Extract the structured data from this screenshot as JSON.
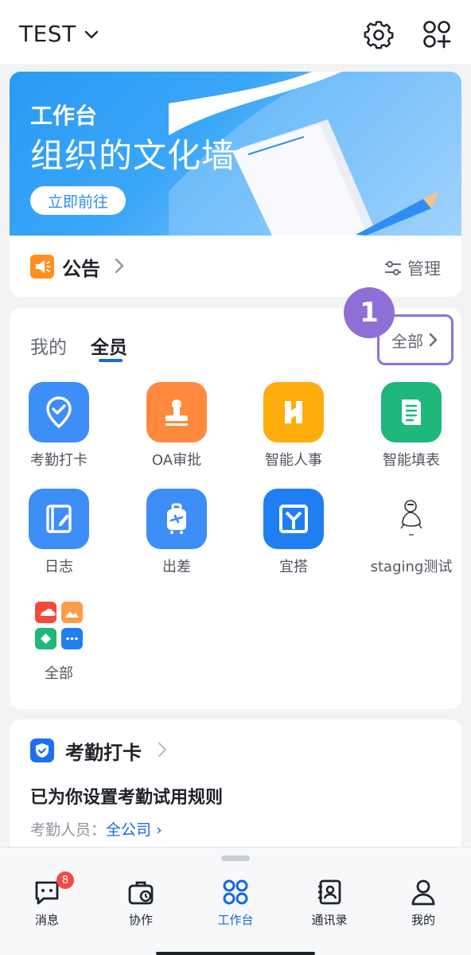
{
  "header": {
    "org_name": "TEST",
    "icons": [
      "gear-icon",
      "add-app-icon"
    ]
  },
  "banner": {
    "title": "工作台",
    "subtitle": "组织的文化墙",
    "button_label": "立即前往",
    "accent": "#2e8ef0"
  },
  "announcement": {
    "label": "公告",
    "manage_label": "管理"
  },
  "apps_section": {
    "tab_mine": "我的",
    "tab_all": "全员",
    "all_link": "全部",
    "step_badge": "1",
    "apps": [
      {
        "label": "考勤打卡",
        "icon": "location-check-icon",
        "color": "#3d8ef7"
      },
      {
        "label": "OA审批",
        "icon": "stamp-icon",
        "color": "#ff8a3d"
      },
      {
        "label": "智能人事",
        "icon": "hr-icon",
        "color": "#ffad0d"
      },
      {
        "label": "智能填表",
        "icon": "form-icon",
        "color": "#1fb77a"
      },
      {
        "label": "日志",
        "icon": "journal-icon",
        "color": "#3d8ef7"
      },
      {
        "label": "出差",
        "icon": "luggage-icon",
        "color": "#3d8ef7"
      },
      {
        "label": "宜搭",
        "icon": "yida-icon",
        "color": "#1f7ef2"
      },
      {
        "label": "staging测试",
        "icon": "sketch-figure-icon",
        "color": "#ffffff"
      },
      {
        "label": "全部",
        "icon": "app-grid-icon",
        "color": "#ffffff"
      }
    ]
  },
  "attendance": {
    "title": "考勤打卡",
    "message": "已为你设置考勤试用规则",
    "people_label": "考勤人员：",
    "people_value": "全公司"
  },
  "tabbar": {
    "items": [
      {
        "label": "消息",
        "badge": "8"
      },
      {
        "label": "协作"
      },
      {
        "label": "工作台"
      },
      {
        "label": "通讯录"
      },
      {
        "label": "我的"
      }
    ],
    "active_color": "#1668dc"
  }
}
